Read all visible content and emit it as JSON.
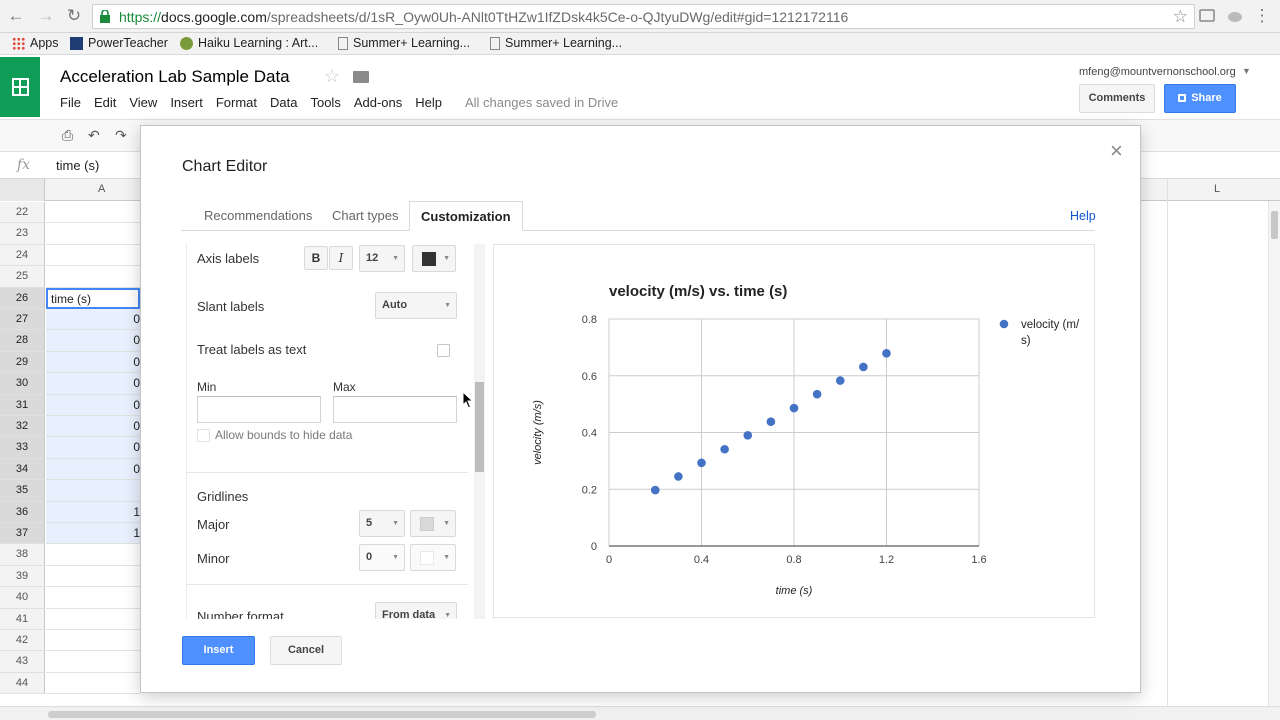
{
  "browser": {
    "url_scheme": "https://",
    "url_host": "docs.google.com",
    "url_path": "/spreadsheets/d/1sR_Oyw0Uh-ANlt0TtHZw1IfZDsk4k5Ce-o-QJtyuDWg/edit#gid=1212172116",
    "bookmarks": [
      "Apps",
      "PowerTeacher",
      "Haiku Learning : Art...",
      "Summer+ Learning...",
      "Summer+ Learning..."
    ]
  },
  "doc": {
    "title": "Acceleration Lab Sample Data",
    "menus": [
      "File",
      "Edit",
      "View",
      "Insert",
      "Format",
      "Data",
      "Tools",
      "Add-ons",
      "Help"
    ],
    "saved_status": "All changes saved in Drive",
    "account": "mfeng@mountvernonschool.org",
    "comments_label": "Comments",
    "share_label": "Share"
  },
  "formula_bar": {
    "fx": "fx",
    "value": "time (s)"
  },
  "grid": {
    "col_a": "A",
    "col_l": "L",
    "rows": [
      {
        "num": "22",
        "a": ""
      },
      {
        "num": "23",
        "a": ""
      },
      {
        "num": "24",
        "a": ""
      },
      {
        "num": "25",
        "a": ""
      },
      {
        "num": "26",
        "a": "time (s)"
      },
      {
        "num": "27",
        "a": "0"
      },
      {
        "num": "28",
        "a": "0"
      },
      {
        "num": "29",
        "a": "0"
      },
      {
        "num": "30",
        "a": "0"
      },
      {
        "num": "31",
        "a": "0"
      },
      {
        "num": "32",
        "a": "0"
      },
      {
        "num": "33",
        "a": "0"
      },
      {
        "num": "34",
        "a": "0"
      },
      {
        "num": "35",
        "a": ""
      },
      {
        "num": "36",
        "a": "1"
      },
      {
        "num": "37",
        "a": "1"
      },
      {
        "num": "38",
        "a": ""
      },
      {
        "num": "39",
        "a": ""
      },
      {
        "num": "40",
        "a": ""
      },
      {
        "num": "41",
        "a": ""
      },
      {
        "num": "42",
        "a": ""
      },
      {
        "num": "43",
        "a": ""
      },
      {
        "num": "44",
        "a": ""
      }
    ]
  },
  "editor": {
    "title": "Chart Editor",
    "tabs": [
      "Recommendations",
      "Chart types",
      "Customization"
    ],
    "active_tab": "Customization",
    "help": "Help",
    "axis_labels": "Axis labels",
    "bold": "B",
    "italic": "I",
    "font_size": "12",
    "slant_labels": "Slant labels",
    "slant_value": "Auto",
    "treat_labels_as_text": "Treat labels as text",
    "min_label": "Min",
    "max_label": "Max",
    "allow_bounds": "Allow bounds to hide data",
    "gridlines": "Gridlines",
    "major": "Major",
    "major_value": "5",
    "minor": "Minor",
    "minor_value": "0",
    "number_format": "Number format",
    "number_format_value": "From data",
    "insert_label": "Insert",
    "cancel_label": "Cancel",
    "text_color": "#333333"
  },
  "chart_data": {
    "type": "scatter",
    "title": "velocity (m/s) vs. time (s)",
    "xlabel": "time (s)",
    "ylabel": "velocity (m/s)",
    "xlim": [
      0,
      1.6
    ],
    "ylim": [
      0,
      0.8
    ],
    "xticks": [
      "0",
      "0.4",
      "0.8",
      "1.2",
      "1.6"
    ],
    "yticks": [
      "0",
      "0.2",
      "0.4",
      "0.6",
      "0.8"
    ],
    "grid": true,
    "legend_position": "right",
    "series": [
      {
        "name": "velocity (m/s)",
        "color": "#4472c4",
        "x": [
          0.2,
          0.3,
          0.4,
          0.5,
          0.6,
          0.7,
          0.8,
          0.9,
          1.0,
          1.1,
          1.2
        ],
        "y": [
          0.197,
          0.245,
          0.293,
          0.341,
          0.39,
          0.438,
          0.486,
          0.535,
          0.583,
          0.631,
          0.679
        ]
      }
    ]
  }
}
